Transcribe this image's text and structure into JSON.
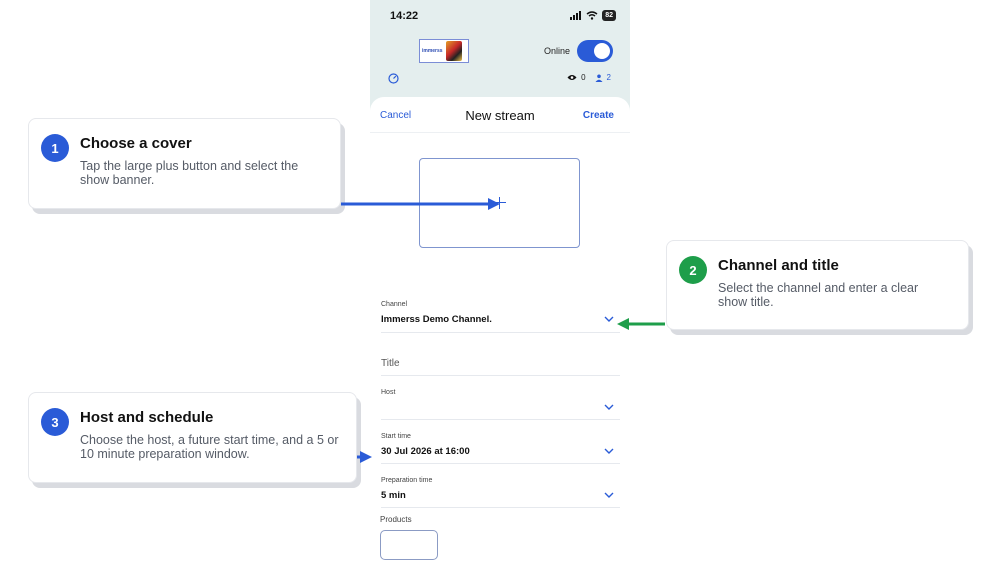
{
  "status_bar": {
    "time": "14:22",
    "battery": "82"
  },
  "header": {
    "logo_text": "immerss",
    "online_label": "Online",
    "viewers_count": "0",
    "participants_count": "2"
  },
  "sheet": {
    "cancel_label": "Cancel",
    "title": "New stream",
    "create_label": "Create",
    "fields": {
      "channel": {
        "label": "Channel",
        "value": "Immerss Demo Channel."
      },
      "title": {
        "placeholder": "Title"
      },
      "host": {
        "label": "Host",
        "value": ""
      },
      "start_time": {
        "label": "Start time",
        "value": "30 Jul 2026 at 16:00"
      },
      "preparation_time": {
        "label": "Preparation time",
        "value": "5 min"
      }
    },
    "products_label": "Products"
  },
  "callouts": [
    {
      "number": "1",
      "title": "Choose a cover",
      "body": "Tap the large plus button and select the show banner.",
      "color": "#2a5bd7"
    },
    {
      "number": "2",
      "title": "Channel and title",
      "body": "Select the channel and enter a clear show title.",
      "color": "#1e9e4a"
    },
    {
      "number": "3",
      "title": "Host and schedule",
      "body": "Choose the host, a future start time, and a 5 or 10 minute preparation window.",
      "color": "#2a5bd7"
    }
  ],
  "colors": {
    "accent": "#2a5bd7",
    "green": "#1e9e4a",
    "phone_bg": "#e4eeee"
  },
  "icons": [
    "signal-icon",
    "wifi-icon",
    "battery-icon",
    "gauge-icon",
    "eye-icon",
    "user-icon",
    "plus-icon",
    "chevron-down-icon"
  ]
}
